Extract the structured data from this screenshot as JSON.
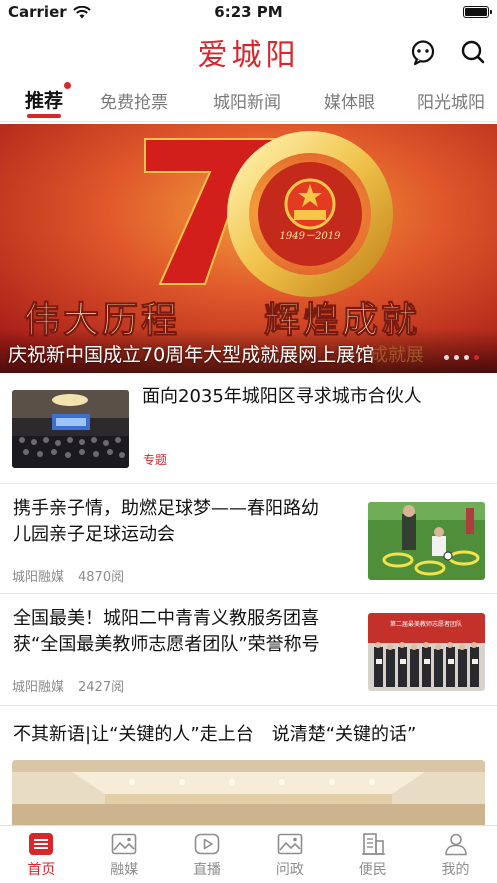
{
  "status_bar": {
    "carrier": "Carrier",
    "time": "6:23 PM",
    "battery_level": 1.0
  },
  "header": {
    "title": "爱城阳"
  },
  "tabs": [
    {
      "label": "推荐",
      "active": true,
      "has_dot": true
    },
    {
      "label": "免费抢票"
    },
    {
      "label": "城阳新闻"
    },
    {
      "label": "媒体眼"
    },
    {
      "label": "阳光城阳"
    }
  ],
  "banner": {
    "caption": "庆祝新中国成立70周年大型成就展网上展馆",
    "image_text": {
      "years": "1949－2019",
      "slogan_left": "伟大历程",
      "slogan_right": "辉煌成就",
      "faded": "成就展"
    },
    "dots_total": 4,
    "dots_active_index": 3
  },
  "articles": [
    {
      "title": "面向2035年城阳区寻求城市合伙人",
      "tag": "专题"
    },
    {
      "title_line1": "携手亲子情，助燃足球梦——春阳路幼",
      "title_line2": "儿园亲子足球运动会",
      "source": "城阳融媒",
      "reads": "4870阅"
    },
    {
      "title_line1": "全国最美！城阳二中青青义教服务团喜",
      "title_line2": "获“全国最美教师志愿者团队”荣誉称号",
      "source": "城阳融媒",
      "reads": "2427阅",
      "photo_banner": "第二届最美教师志愿者团队"
    },
    {
      "title": "不其新语|让“关键的人”走上台　说清楚“关键的话”"
    }
  ],
  "tabbar": [
    {
      "label": "首页",
      "icon": "home-list-icon",
      "active": true
    },
    {
      "label": "融媒",
      "icon": "image-icon"
    },
    {
      "label": "直播",
      "icon": "play-icon"
    },
    {
      "label": "问政",
      "icon": "image-icon"
    },
    {
      "label": "便民",
      "icon": "building-icon"
    },
    {
      "label": "我的",
      "icon": "person-icon"
    }
  ],
  "colors": {
    "accent": "#d8262b",
    "muted_text": "#8c8c8c",
    "divider": "#e6e6e6"
  }
}
